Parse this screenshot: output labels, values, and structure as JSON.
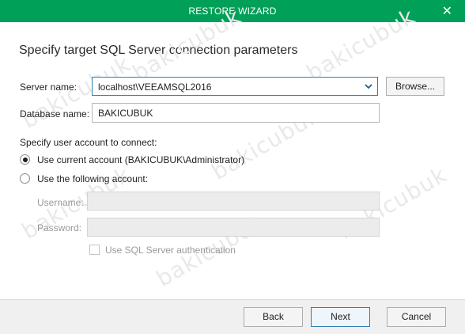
{
  "window": {
    "title": "RESTORE WIZARD"
  },
  "page": {
    "heading": "Specify target SQL Server connection parameters"
  },
  "server": {
    "label": "Server name:",
    "value": "localhost\\VEEAMSQL2016",
    "browse_label": "Browse..."
  },
  "database": {
    "label": "Database name:",
    "value": "BAKICUBUK"
  },
  "account": {
    "section_label": "Specify user account to connect:",
    "current_option": "Use current account (BAKICUBUK\\Administrator)",
    "other_option": "Use the following account:",
    "selected": "current",
    "username_label": "Username:",
    "username_value": "",
    "password_label": "Password:",
    "password_value": "",
    "sql_auth_label": "Use SQL Server authentication",
    "sql_auth_checked": false
  },
  "footer": {
    "back_label": "Back",
    "next_label": "Next",
    "cancel_label": "Cancel"
  },
  "watermark": {
    "text": "bakicubuk"
  }
}
